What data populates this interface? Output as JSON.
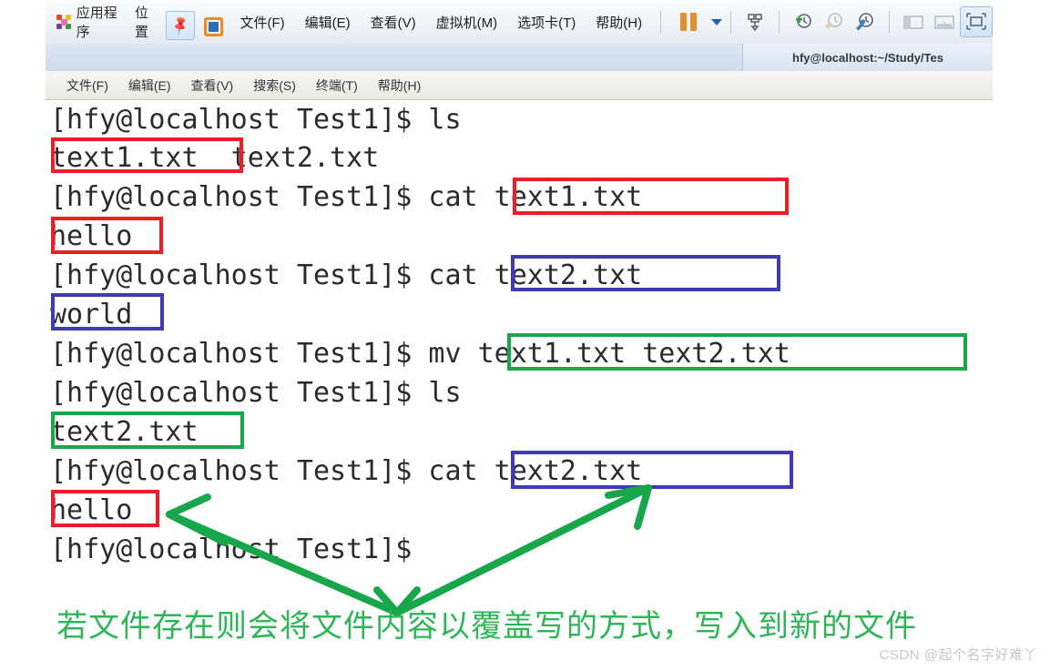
{
  "vmware": {
    "gnome": {
      "applications": "应用程序",
      "places": "位置"
    },
    "pin_icon": "pushpin-icon",
    "logo_icon": "vmware-logo-icon",
    "menus": [
      {
        "label": "文件(F)",
        "name": "menu-file"
      },
      {
        "label": "编辑(E)",
        "name": "menu-edit"
      },
      {
        "label": "查看(V)",
        "name": "menu-view"
      },
      {
        "label": "虚拟机(M)",
        "name": "menu-vm"
      },
      {
        "label": "选项卡(T)",
        "name": "menu-tabs"
      },
      {
        "label": "帮助(H)",
        "name": "menu-help"
      }
    ],
    "toolbar": {
      "pause": "pause-icon",
      "pause_dropdown": "chevron-down-icon",
      "send_cad": "send-ctrl-alt-del-icon",
      "snapshot_take": "take-snapshot-icon",
      "snapshot_revert": "revert-snapshot-icon",
      "snapshot_manage": "manage-snapshots-icon",
      "view_sidebar": "show-sidebar-icon",
      "view_console": "show-console-icon",
      "view_fullscreen": "enter-fullscreen-icon"
    },
    "tab_title": "hfy@localhost:~/Study/Tes"
  },
  "terminal": {
    "menus": [
      {
        "label": "文件(F)",
        "name": "term-menu-file"
      },
      {
        "label": "编辑(E)",
        "name": "term-menu-edit"
      },
      {
        "label": "查看(V)",
        "name": "term-menu-view"
      },
      {
        "label": "搜索(S)",
        "name": "term-menu-search"
      },
      {
        "label": "终端(T)",
        "name": "term-menu-terminal"
      },
      {
        "label": "帮助(H)",
        "name": "term-menu-help"
      }
    ],
    "prompt": "[hfy@localhost Test1]$ ",
    "lines": [
      {
        "text": "[hfy@localhost Test1]$ ls"
      },
      {
        "text": "text1.txt  text2.txt"
      },
      {
        "text": "[hfy@localhost Test1]$ cat text1.txt"
      },
      {
        "text": "hello"
      },
      {
        "text": "[hfy@localhost Test1]$ cat text2.txt"
      },
      {
        "text": "world"
      },
      {
        "text": "[hfy@localhost Test1]$ mv text1.txt text2.txt"
      },
      {
        "text": "[hfy@localhost Test1]$ ls"
      },
      {
        "text": "text2.txt"
      },
      {
        "text": "[hfy@localhost Test1]$ cat text2.txt"
      },
      {
        "text": "hello"
      },
      {
        "text": "[hfy@localhost Test1]$ "
      }
    ]
  },
  "annotations": {
    "note": "若文件存在则会将文件内容以覆盖写的方式，写入到新的文件",
    "watermark": "CSDN @起个名字好难丫",
    "colors": {
      "red": "#ef1d26",
      "blue": "#3f3bb5",
      "green": "#18a64a",
      "note": "#2fb457"
    },
    "boxes": [
      {
        "name": "highlight-text1-txt",
        "color": "red"
      },
      {
        "name": "highlight-cat-text1",
        "color": "red"
      },
      {
        "name": "highlight-hello-first",
        "color": "red"
      },
      {
        "name": "highlight-cat-text2-first",
        "color": "blue"
      },
      {
        "name": "highlight-world",
        "color": "blue"
      },
      {
        "name": "highlight-mv-command",
        "color": "green"
      },
      {
        "name": "highlight-text2-txt-after",
        "color": "green"
      },
      {
        "name": "highlight-cat-text2-second",
        "color": "blue"
      },
      {
        "name": "highlight-hello-second",
        "color": "red"
      }
    ]
  }
}
